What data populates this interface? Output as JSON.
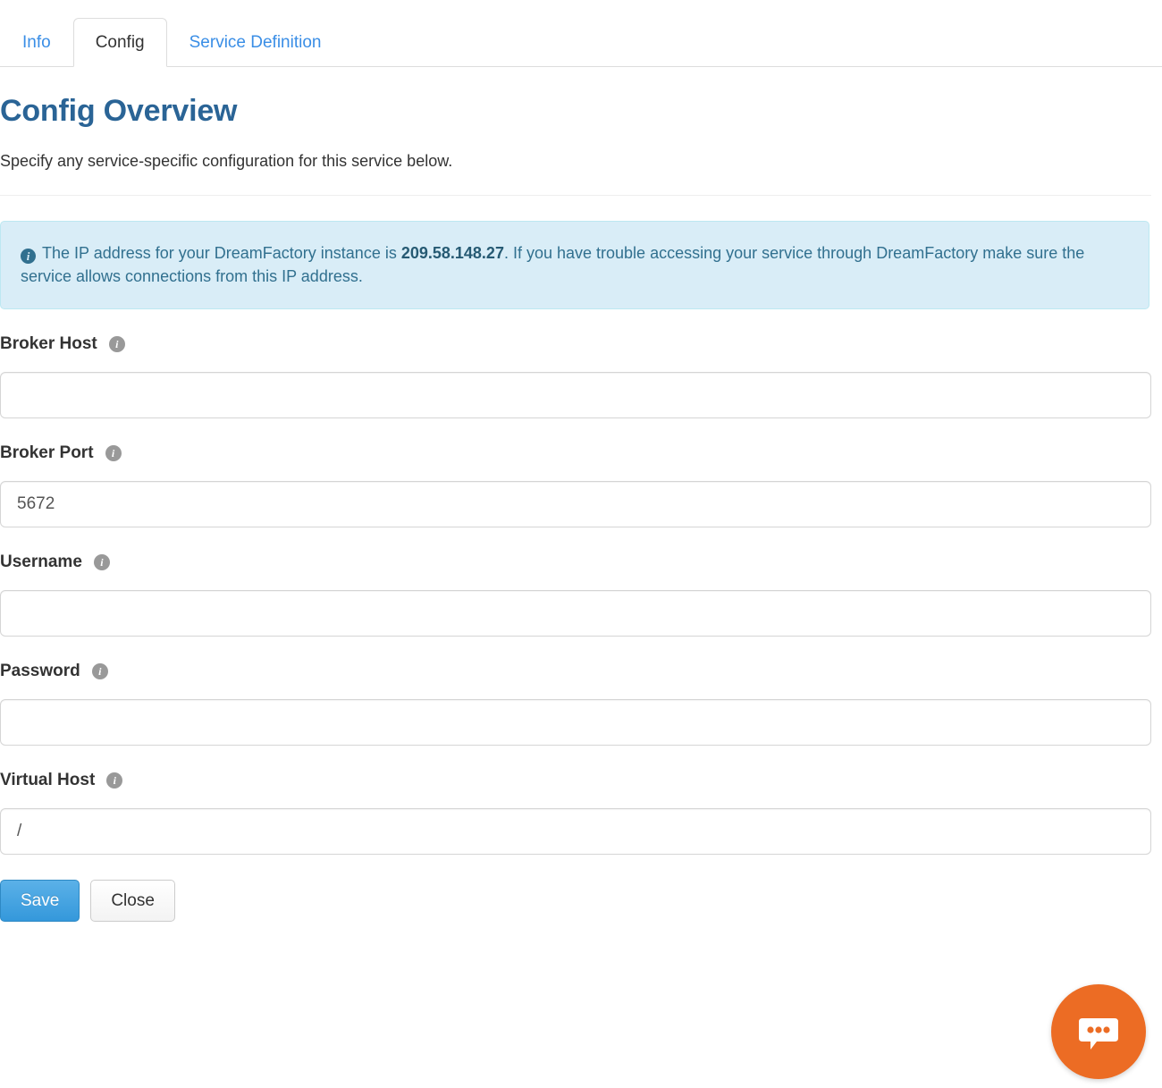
{
  "tabs": [
    {
      "label": "Info",
      "active": false
    },
    {
      "label": "Config",
      "active": true
    },
    {
      "label": "Service Definition",
      "active": false
    }
  ],
  "page": {
    "title": "Config Overview",
    "description": "Specify any service-specific configuration for this service below."
  },
  "alert": {
    "icon": "info-circle-icon",
    "text_before": "The IP address for your DreamFactory instance is",
    "ip_address": "209.58.148.27",
    "text_after": ". If you have trouble accessing your service through DreamFactory make sure the service allows connections from this IP address."
  },
  "fields": [
    {
      "label": "Broker Host",
      "value": "",
      "placeholder": "",
      "tip_icon": "info-icon",
      "name": "broker-host"
    },
    {
      "label": "Broker Port",
      "value": "5672",
      "placeholder": "",
      "tip_icon": "info-icon",
      "name": "broker-port"
    },
    {
      "label": "Username",
      "value": "",
      "placeholder": "",
      "tip_icon": "info-icon",
      "name": "username"
    },
    {
      "label": "Password",
      "value": "",
      "placeholder": "",
      "tip_icon": "info-icon",
      "name": "password"
    },
    {
      "label": "Virtual Host",
      "value": "/",
      "placeholder": "",
      "tip_icon": "info-icon",
      "name": "virtual-host"
    }
  ],
  "buttons": {
    "save_label": "Save",
    "close_label": "Close"
  },
  "chat": {
    "icon": "chat-bubble-icon",
    "color": "#ec6c24"
  },
  "colors": {
    "link": "#3a8ee6",
    "title": "#2a6496",
    "alert_bg": "#d9edf7",
    "alert_border": "#bce8f1",
    "alert_text": "#31708f",
    "primary_button": "#3498db",
    "tip_icon": "#999999"
  }
}
